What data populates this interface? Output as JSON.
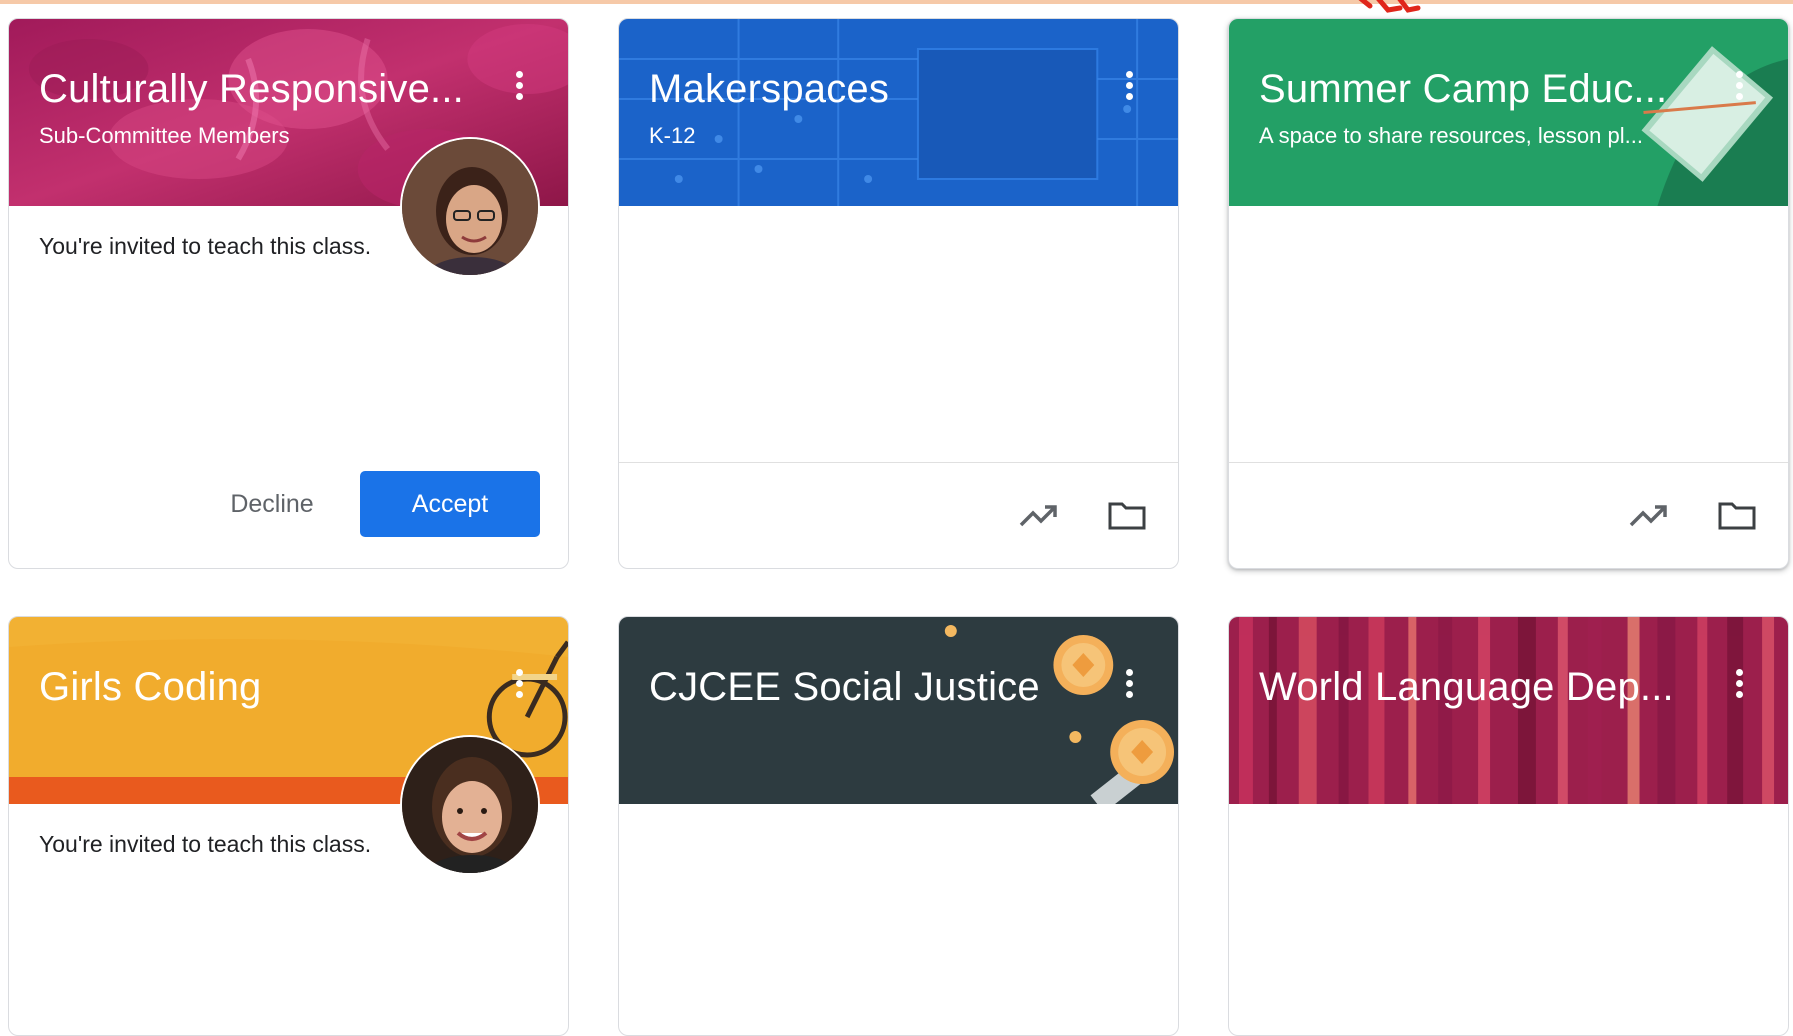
{
  "colors": {
    "accent_blue": "#1a73e8",
    "card_border": "#dadce0",
    "text_dark": "#202124",
    "text_muted": "#5f6368"
  },
  "classes": [
    {
      "title": "Culturally Responsive...",
      "subtitle": "Sub-Committee Members",
      "theme": "magenta-roses",
      "invite_text": "You're invited to teach this class.",
      "decline_label": "Decline",
      "accept_label": "Accept",
      "icons": [
        "more-vert-icon",
        "teacher-avatar"
      ]
    },
    {
      "title": "Makerspaces",
      "subtitle": "K-12",
      "theme": "blue-circuit-board",
      "icons": [
        "more-vert-icon",
        "trending-up-icon",
        "folder-icon"
      ]
    },
    {
      "title": "Summer Camp Educ...",
      "subtitle": "A space to share resources, lesson pl...",
      "theme": "green-book",
      "icons": [
        "more-vert-icon",
        "trending-up-icon",
        "folder-icon"
      ]
    },
    {
      "title": "Girls Coding",
      "subtitle": "",
      "theme": "orange-bicycle",
      "invite_text": "You're invited to teach this class.",
      "icons": [
        "more-vert-icon",
        "teacher-avatar"
      ]
    },
    {
      "title": "CJCEE Social Justice",
      "subtitle": "",
      "theme": "dark-slate-coins",
      "icons": [
        "more-vert-icon"
      ]
    },
    {
      "title": "World Language Dep...",
      "subtitle": "",
      "theme": "magenta-yarn",
      "icons": [
        "more-vert-icon"
      ]
    }
  ]
}
